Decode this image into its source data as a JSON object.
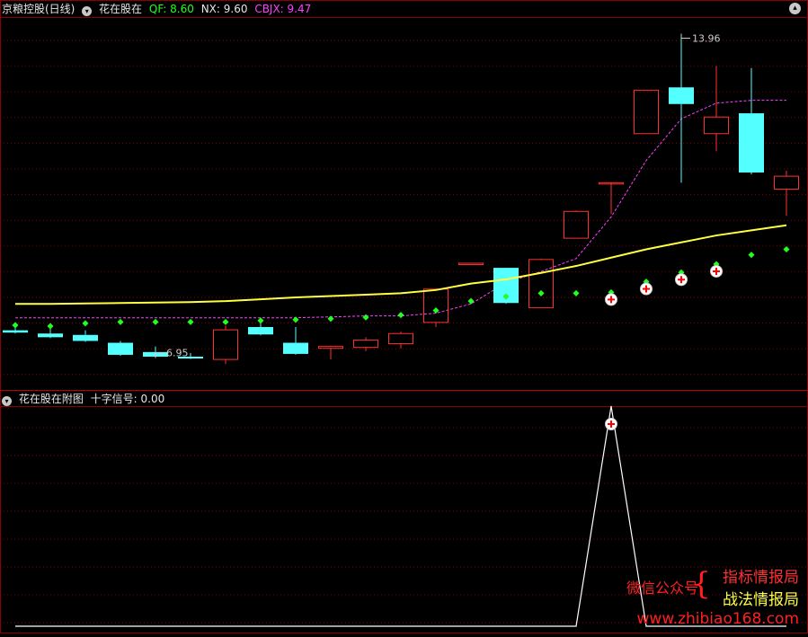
{
  "main_header": {
    "title": "京粮控股(日线)",
    "indicator": "花在股在",
    "qf_label": "QF: 8.60",
    "nx_label": "NX: 9.60",
    "cbjx_label": "CBJX: 9.47"
  },
  "sub_header": {
    "title": "花在股在附图",
    "signal_label": "十字信号: 0.00"
  },
  "watermark": {
    "wechat": "微信公众号",
    "line1": "指标情报局",
    "line2": "战法情报局",
    "site": "www.zhibiao168.com"
  },
  "colors": {
    "up": "#ff3030",
    "down": "#54ffff",
    "ma": "#ffff40",
    "cbjx": "#ff40ff",
    "dot": "#20ff20",
    "signal_line": "#ffffff",
    "grid": "#8b0000"
  },
  "chart_data": [
    {
      "type": "candlestick",
      "title": "京粮控股(日线)",
      "ylim": [
        6.3,
        14.3
      ],
      "annotations": [
        {
          "text": "13.96",
          "x": 19,
          "y": 13.96
        },
        {
          "text": "6.95",
          "x": 4,
          "y": 6.95
        }
      ],
      "candles": [
        {
          "o": 7.55,
          "h": 7.62,
          "l": 7.48,
          "c": 7.5
        },
        {
          "o": 7.48,
          "h": 7.58,
          "l": 7.38,
          "c": 7.4
        },
        {
          "o": 7.45,
          "h": 7.55,
          "l": 7.3,
          "c": 7.32
        },
        {
          "o": 7.28,
          "h": 7.32,
          "l": 7.0,
          "c": 7.02
        },
        {
          "o": 7.08,
          "h": 7.2,
          "l": 6.95,
          "c": 6.98
        },
        {
          "o": 6.98,
          "h": 7.06,
          "l": 6.93,
          "c": 6.94
        },
        {
          "o": 6.92,
          "h": 7.65,
          "l": 6.82,
          "c": 7.56
        },
        {
          "o": 7.62,
          "h": 7.78,
          "l": 7.44,
          "c": 7.46
        },
        {
          "o": 7.28,
          "h": 7.62,
          "l": 7.02,
          "c": 7.04
        },
        {
          "o": 7.16,
          "h": 7.22,
          "l": 6.92,
          "c": 7.2
        },
        {
          "o": 7.18,
          "h": 7.4,
          "l": 7.1,
          "c": 7.34
        },
        {
          "o": 7.26,
          "h": 7.52,
          "l": 7.16,
          "c": 7.48
        },
        {
          "o": 7.72,
          "h": 8.46,
          "l": 7.62,
          "c": 8.44
        },
        {
          "o": 9.0,
          "h": 9.0,
          "l": 9.0,
          "c": 9.0
        },
        {
          "o": 8.9,
          "h": 8.9,
          "l": 8.12,
          "c": 8.14
        },
        {
          "o": 8.04,
          "h": 9.1,
          "l": 8.04,
          "c": 9.08
        },
        {
          "o": 9.54,
          "h": 10.14,
          "l": 9.54,
          "c": 10.12
        },
        {
          "o": 10.74,
          "h": 10.74,
          "l": 10.06,
          "c": 10.74
        },
        {
          "o": 11.8,
          "h": 12.74,
          "l": 11.8,
          "c": 12.74
        },
        {
          "o": 12.8,
          "h": 13.96,
          "l": 10.74,
          "c": 12.44
        },
        {
          "o": 11.8,
          "h": 13.26,
          "l": 11.42,
          "c": 12.16
        },
        {
          "o": 12.24,
          "h": 13.22,
          "l": 10.92,
          "c": 10.96
        },
        {
          "o": 10.6,
          "h": 11.0,
          "l": 10.02,
          "c": 10.88
        }
      ],
      "series": [
        {
          "name": "QF",
          "style": "dots",
          "values": [
            7.66,
            7.64,
            7.7,
            7.73,
            7.73,
            7.73,
            7.73,
            7.76,
            7.78,
            7.8,
            7.83,
            7.88,
            7.98,
            8.18,
            8.28,
            8.35,
            8.35,
            8.37,
            8.6,
            8.8,
            8.98,
            9.18,
            9.3
          ]
        },
        {
          "name": "NX",
          "style": "line",
          "values": [
            8.12,
            8.12,
            8.13,
            8.14,
            8.15,
            8.16,
            8.18,
            8.22,
            8.26,
            8.29,
            8.32,
            8.35,
            8.42,
            8.56,
            8.65,
            8.79,
            8.94,
            9.12,
            9.3,
            9.45,
            9.6,
            9.71,
            9.82
          ]
        },
        {
          "name": "CBJX",
          "style": "dashed",
          "values": [
            7.82,
            7.82,
            7.82,
            7.82,
            7.82,
            7.82,
            7.82,
            7.82,
            7.82,
            7.84,
            7.86,
            7.86,
            7.92,
            8.12,
            8.58,
            8.82,
            9.1,
            10.0,
            11.22,
            12.12,
            12.46,
            12.52,
            12.52
          ]
        }
      ],
      "cross_markers": [
        17,
        18,
        19,
        20
      ]
    },
    {
      "type": "line",
      "title": "花在股在附图",
      "ylim": [
        0,
        1
      ],
      "series": [
        {
          "name": "十字信号",
          "values": [
            0,
            0,
            0,
            0,
            0,
            0,
            0,
            0,
            0,
            0,
            0,
            0,
            0,
            0,
            0,
            0,
            0,
            1,
            0,
            0,
            0,
            0,
            0
          ]
        }
      ],
      "cross_markers": [
        17
      ]
    }
  ]
}
